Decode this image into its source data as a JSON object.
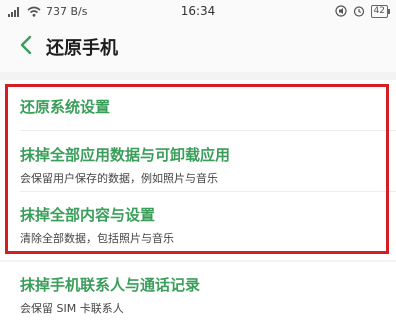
{
  "status_bar": {
    "network_speed": "737 B/s",
    "time": "16:34",
    "battery": "42"
  },
  "header": {
    "title": "还原手机"
  },
  "options": [
    {
      "title": "还原系统设置",
      "subtitle": ""
    },
    {
      "title": "抹掉全部应用数据与可卸载应用",
      "subtitle": "会保留用户保存的数据，例如照片与音乐"
    },
    {
      "title": "抹掉全部内容与设置",
      "subtitle": "清除全部数据，包括照片与音乐"
    },
    {
      "title": "抹掉手机联系人与通话记录",
      "subtitle": "会保留 SIM 卡联系人"
    }
  ],
  "colors": {
    "accent_green": "#3a9e5a",
    "highlight_red": "#d41f22"
  }
}
